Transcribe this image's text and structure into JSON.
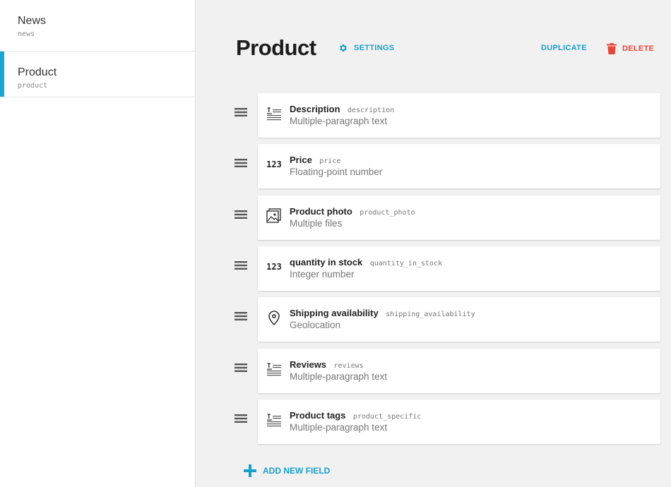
{
  "sidebar": {
    "items": [
      {
        "title": "News",
        "slug": "news"
      },
      {
        "title": "Product",
        "slug": "product"
      }
    ]
  },
  "header": {
    "title": "Product",
    "settings_label": "SETTINGS",
    "duplicate_label": "DUPLICATE",
    "delete_label": "DELETE"
  },
  "fields": [
    {
      "name": "Description",
      "api": "description",
      "type": "Multiple-paragraph text",
      "icon": "text-paragraph-icon"
    },
    {
      "name": "Price",
      "api": "price",
      "type": "Floating-point number",
      "icon": "number-icon",
      "icon_text": "123"
    },
    {
      "name": "Product photo",
      "api": "product_photo",
      "type": "Multiple files",
      "icon": "image-gallery-icon"
    },
    {
      "name": "quantity in stock",
      "api": "quantity_in_stock",
      "type": "Integer number",
      "icon": "number-icon",
      "icon_text": "123"
    },
    {
      "name": "Shipping availability",
      "api": "shipping_availability",
      "type": "Geolocation",
      "icon": "map-pin-icon"
    },
    {
      "name": "Reviews",
      "api": "reviews",
      "type": "Multiple-paragraph text",
      "icon": "text-paragraph-icon"
    },
    {
      "name": "Product tags",
      "api": "product_specific",
      "type": "Multiple-paragraph text",
      "icon": "text-paragraph-icon"
    }
  ],
  "add_field_label": "ADD NEW FIELD",
  "colors": {
    "accent": "#1a9fc9",
    "danger": "#e9463a",
    "active_bar": "#19a5d4"
  }
}
